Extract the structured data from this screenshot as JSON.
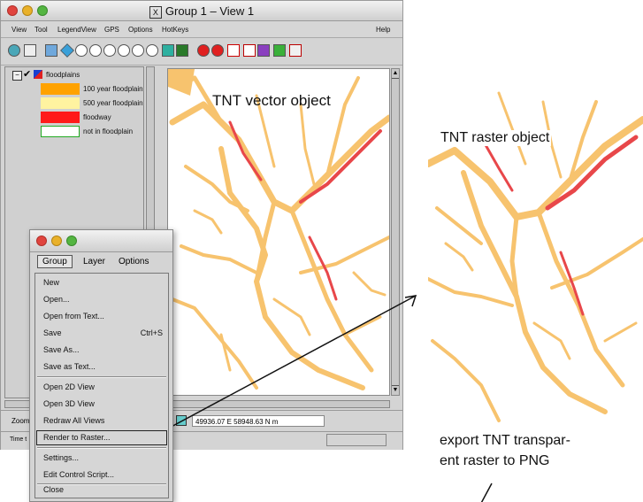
{
  "window": {
    "title": "Group 1 – View 1",
    "x_glyph": "X"
  },
  "menubar": [
    "View",
    "Tool",
    "LegendView",
    "GPS",
    "Options",
    "HotKeys"
  ],
  "menubar_help": "Help",
  "legend": {
    "layer_name": "floodplains",
    "entries": [
      {
        "label": "100 year floodplain",
        "color": "#ffa200"
      },
      {
        "label": "500 year floodplain",
        "color": "#fff3a0"
      },
      {
        "label": "floodway",
        "color": "#ff1a1a"
      },
      {
        "label": "not in floodplain",
        "color": "#ffffff"
      }
    ]
  },
  "status": {
    "zoom_label": "Zoom",
    "time_label": "Time t",
    "coordinates": "49936.07 E 58948.63 N m"
  },
  "group_dialog": {
    "menubar": [
      "Group",
      "Layer",
      "Options"
    ],
    "items": [
      {
        "label": "New",
        "shortcut": ""
      },
      {
        "label": "Open...",
        "shortcut": ""
      },
      {
        "label": "Open from Text...",
        "shortcut": ""
      },
      {
        "label": "Save",
        "shortcut": "Ctrl+S"
      },
      {
        "label": "Save As...",
        "shortcut": ""
      },
      {
        "label": "Save as Text...",
        "shortcut": ""
      },
      {
        "label": "Open 2D View",
        "shortcut": ""
      },
      {
        "label": "Open 3D View",
        "shortcut": ""
      },
      {
        "label": "Redraw All Views",
        "shortcut": ""
      },
      {
        "label": "Render to Raster...",
        "shortcut": ""
      },
      {
        "label": "Settings...",
        "shortcut": ""
      },
      {
        "label": "Edit Control Script...",
        "shortcut": ""
      },
      {
        "label": "Close",
        "shortcut": ""
      }
    ]
  },
  "annotations": {
    "vector": "TNT vector object",
    "raster": "TNT raster object",
    "export_line1": "export TNT transpar-",
    "export_line2": "ent raster to PNG"
  },
  "colors": {
    "floodplain_100": "#f7c36e",
    "floodplain_500": "#fff3a0",
    "floodway": "#e8474a"
  }
}
